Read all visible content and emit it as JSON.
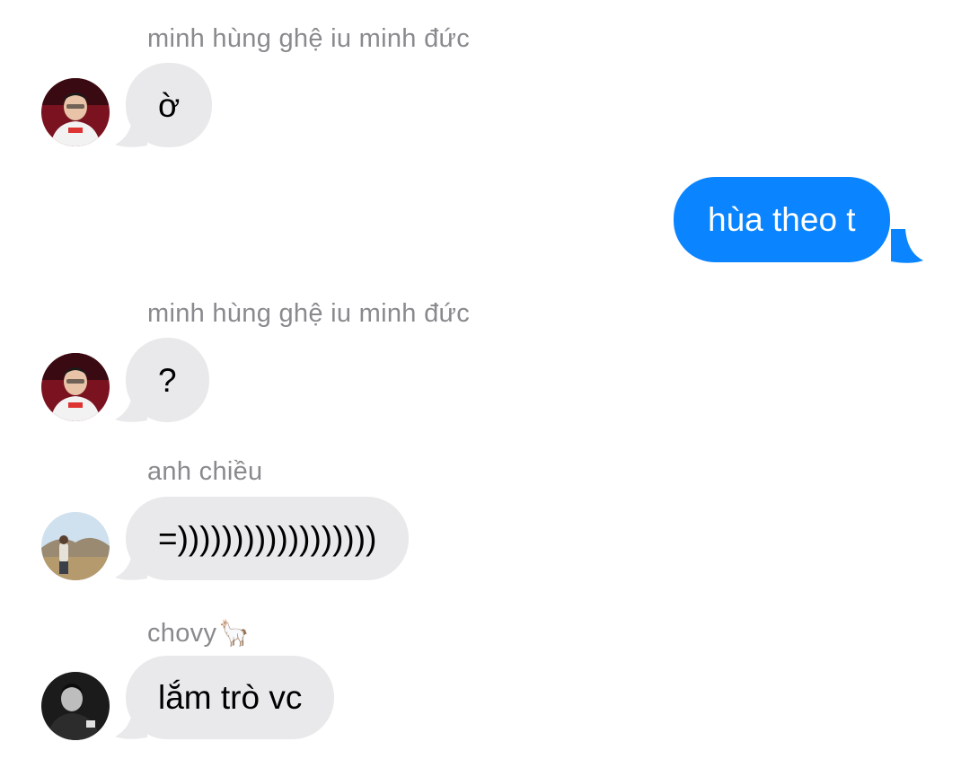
{
  "colors": {
    "incoming_bubble": "#e9e9eb",
    "outgoing_bubble": "#0b84ff",
    "sender_name": "#8a8a8e"
  },
  "messages": [
    {
      "direction": "incoming",
      "sender": "minh hùng ghệ iu minh đức",
      "text": "ờ",
      "avatar": "avatar-red-jersey-player"
    },
    {
      "direction": "outgoing",
      "text": "hùa theo t"
    },
    {
      "direction": "incoming",
      "sender": "minh hùng ghệ iu minh đức",
      "text": "?",
      "avatar": "avatar-red-jersey-player"
    },
    {
      "direction": "incoming",
      "sender": "anh chiều",
      "text": "=))))))))))))))))))",
      "avatar": "avatar-landscape-photo"
    },
    {
      "direction": "incoming",
      "sender": "chovy",
      "sender_emoji": "🦙",
      "text": "lắm trò vc",
      "avatar": "avatar-dark-portrait"
    }
  ]
}
